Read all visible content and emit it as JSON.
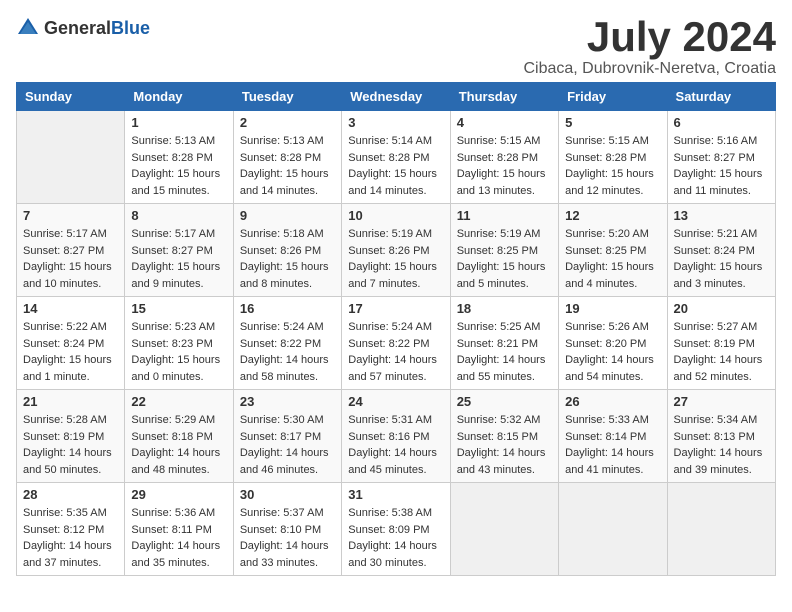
{
  "logo": {
    "text_general": "General",
    "text_blue": "Blue"
  },
  "title": {
    "month_year": "July 2024",
    "location": "Cibaca, Dubrovnik-Neretva, Croatia"
  },
  "headers": [
    "Sunday",
    "Monday",
    "Tuesday",
    "Wednesday",
    "Thursday",
    "Friday",
    "Saturday"
  ],
  "weeks": [
    [
      {
        "day": "",
        "info": ""
      },
      {
        "day": "1",
        "info": "Sunrise: 5:13 AM\nSunset: 8:28 PM\nDaylight: 15 hours\nand 15 minutes."
      },
      {
        "day": "2",
        "info": "Sunrise: 5:13 AM\nSunset: 8:28 PM\nDaylight: 15 hours\nand 14 minutes."
      },
      {
        "day": "3",
        "info": "Sunrise: 5:14 AM\nSunset: 8:28 PM\nDaylight: 15 hours\nand 14 minutes."
      },
      {
        "day": "4",
        "info": "Sunrise: 5:15 AM\nSunset: 8:28 PM\nDaylight: 15 hours\nand 13 minutes."
      },
      {
        "day": "5",
        "info": "Sunrise: 5:15 AM\nSunset: 8:28 PM\nDaylight: 15 hours\nand 12 minutes."
      },
      {
        "day": "6",
        "info": "Sunrise: 5:16 AM\nSunset: 8:27 PM\nDaylight: 15 hours\nand 11 minutes."
      }
    ],
    [
      {
        "day": "7",
        "info": "Sunrise: 5:17 AM\nSunset: 8:27 PM\nDaylight: 15 hours\nand 10 minutes."
      },
      {
        "day": "8",
        "info": "Sunrise: 5:17 AM\nSunset: 8:27 PM\nDaylight: 15 hours\nand 9 minutes."
      },
      {
        "day": "9",
        "info": "Sunrise: 5:18 AM\nSunset: 8:26 PM\nDaylight: 15 hours\nand 8 minutes."
      },
      {
        "day": "10",
        "info": "Sunrise: 5:19 AM\nSunset: 8:26 PM\nDaylight: 15 hours\nand 7 minutes."
      },
      {
        "day": "11",
        "info": "Sunrise: 5:19 AM\nSunset: 8:25 PM\nDaylight: 15 hours\nand 5 minutes."
      },
      {
        "day": "12",
        "info": "Sunrise: 5:20 AM\nSunset: 8:25 PM\nDaylight: 15 hours\nand 4 minutes."
      },
      {
        "day": "13",
        "info": "Sunrise: 5:21 AM\nSunset: 8:24 PM\nDaylight: 15 hours\nand 3 minutes."
      }
    ],
    [
      {
        "day": "14",
        "info": "Sunrise: 5:22 AM\nSunset: 8:24 PM\nDaylight: 15 hours\nand 1 minute."
      },
      {
        "day": "15",
        "info": "Sunrise: 5:23 AM\nSunset: 8:23 PM\nDaylight: 15 hours\nand 0 minutes."
      },
      {
        "day": "16",
        "info": "Sunrise: 5:24 AM\nSunset: 8:22 PM\nDaylight: 14 hours\nand 58 minutes."
      },
      {
        "day": "17",
        "info": "Sunrise: 5:24 AM\nSunset: 8:22 PM\nDaylight: 14 hours\nand 57 minutes."
      },
      {
        "day": "18",
        "info": "Sunrise: 5:25 AM\nSunset: 8:21 PM\nDaylight: 14 hours\nand 55 minutes."
      },
      {
        "day": "19",
        "info": "Sunrise: 5:26 AM\nSunset: 8:20 PM\nDaylight: 14 hours\nand 54 minutes."
      },
      {
        "day": "20",
        "info": "Sunrise: 5:27 AM\nSunset: 8:19 PM\nDaylight: 14 hours\nand 52 minutes."
      }
    ],
    [
      {
        "day": "21",
        "info": "Sunrise: 5:28 AM\nSunset: 8:19 PM\nDaylight: 14 hours\nand 50 minutes."
      },
      {
        "day": "22",
        "info": "Sunrise: 5:29 AM\nSunset: 8:18 PM\nDaylight: 14 hours\nand 48 minutes."
      },
      {
        "day": "23",
        "info": "Sunrise: 5:30 AM\nSunset: 8:17 PM\nDaylight: 14 hours\nand 46 minutes."
      },
      {
        "day": "24",
        "info": "Sunrise: 5:31 AM\nSunset: 8:16 PM\nDaylight: 14 hours\nand 45 minutes."
      },
      {
        "day": "25",
        "info": "Sunrise: 5:32 AM\nSunset: 8:15 PM\nDaylight: 14 hours\nand 43 minutes."
      },
      {
        "day": "26",
        "info": "Sunrise: 5:33 AM\nSunset: 8:14 PM\nDaylight: 14 hours\nand 41 minutes."
      },
      {
        "day": "27",
        "info": "Sunrise: 5:34 AM\nSunset: 8:13 PM\nDaylight: 14 hours\nand 39 minutes."
      }
    ],
    [
      {
        "day": "28",
        "info": "Sunrise: 5:35 AM\nSunset: 8:12 PM\nDaylight: 14 hours\nand 37 minutes."
      },
      {
        "day": "29",
        "info": "Sunrise: 5:36 AM\nSunset: 8:11 PM\nDaylight: 14 hours\nand 35 minutes."
      },
      {
        "day": "30",
        "info": "Sunrise: 5:37 AM\nSunset: 8:10 PM\nDaylight: 14 hours\nand 33 minutes."
      },
      {
        "day": "31",
        "info": "Sunrise: 5:38 AM\nSunset: 8:09 PM\nDaylight: 14 hours\nand 30 minutes."
      },
      {
        "day": "",
        "info": ""
      },
      {
        "day": "",
        "info": ""
      },
      {
        "day": "",
        "info": ""
      }
    ]
  ]
}
